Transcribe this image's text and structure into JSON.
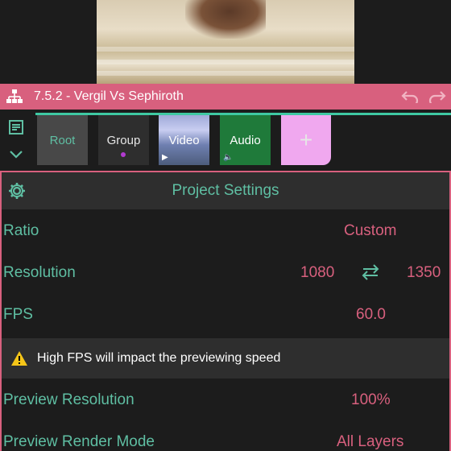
{
  "colors": {
    "accent_pink": "#d8607e",
    "accent_green": "#5fbfa3",
    "teal_line": "#3ec9a3",
    "background": "#1c1c1c",
    "add_tile": "#f0a8ef",
    "audio_tile": "#1f7a3a",
    "warning_yellow": "#f5c518"
  },
  "titlebar": {
    "project_title": "7.5.2 - Vergil Vs Sephiroth",
    "icons": [
      "hierarchy-icon",
      "undo-icon",
      "redo-icon"
    ]
  },
  "layers": {
    "tabs": [
      {
        "label": "Root"
      },
      {
        "label": "Group"
      },
      {
        "label": "Video"
      },
      {
        "label": "Audio"
      },
      {
        "label": "+"
      }
    ]
  },
  "settings": {
    "title": "Project Settings",
    "ratio": {
      "label": "Ratio",
      "value": "Custom"
    },
    "resolution": {
      "label": "Resolution",
      "width": "1080",
      "height": "1350"
    },
    "fps": {
      "label": "FPS",
      "value": "60.0"
    },
    "warning": "High FPS will impact the previewing speed",
    "preview_resolution": {
      "label": "Preview Resolution",
      "value": "100%"
    },
    "preview_render_mode": {
      "label": "Preview Render Mode",
      "value": "All Layers"
    }
  }
}
